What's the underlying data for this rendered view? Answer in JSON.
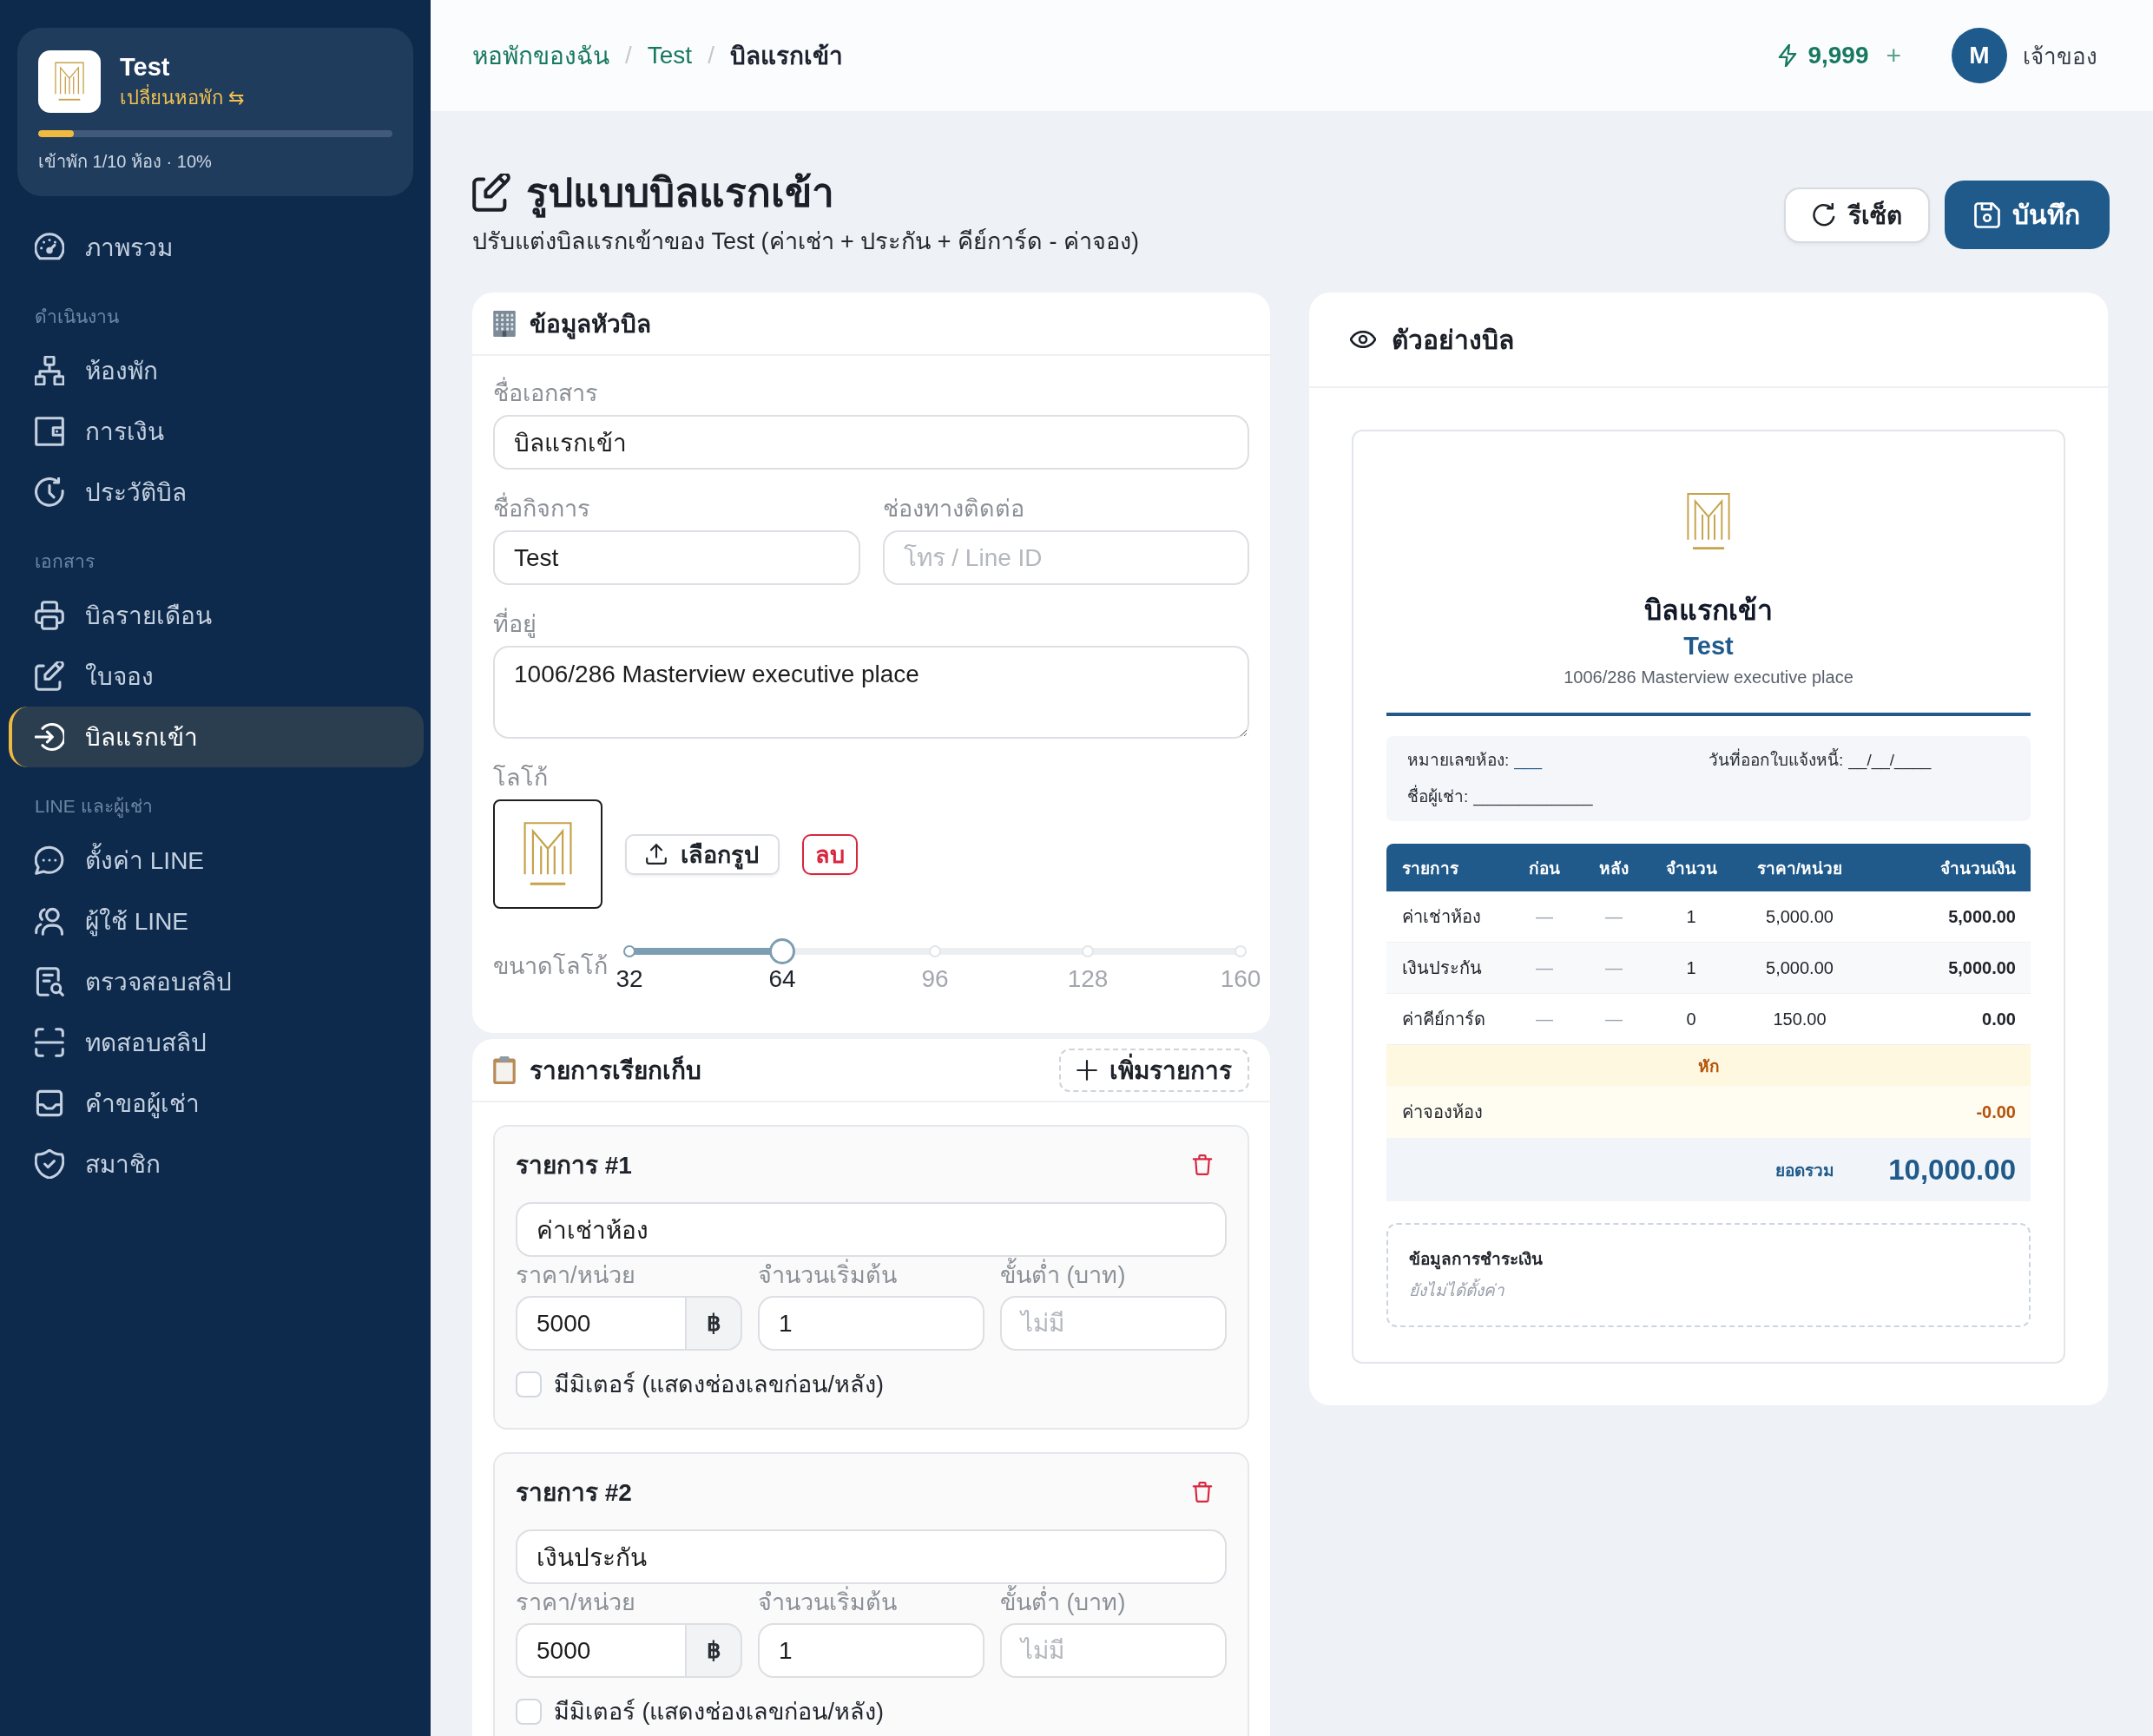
{
  "sidebar": {
    "property": {
      "name": "Test",
      "switch_label": "เปลี่ยนหอพัก ⇆",
      "occupancy": {
        "level": 0.1,
        "text": "เข้าพัก 1/10 ห้อง · 10%"
      }
    },
    "groups": [
      {
        "items": [
          {
            "label": "ภาพรวม",
            "selected": false
          }
        ]
      },
      {
        "heading": "ดำเนินงาน",
        "items": [
          {
            "label": "ห้องพัก",
            "selected": false
          },
          {
            "label": "การเงิน",
            "selected": false
          },
          {
            "label": "ประวัติบิล",
            "selected": false
          }
        ]
      },
      {
        "heading": "เอกสาร",
        "items": [
          {
            "label": "บิลรายเดือน",
            "selected": false
          },
          {
            "label": "ใบจอง",
            "selected": false
          },
          {
            "label": "บิลแรกเข้า",
            "selected": true
          }
        ]
      },
      {
        "heading": "LINE และผู้เช่า",
        "items": [
          {
            "label": "ตั้งค่า LINE",
            "selected": false
          },
          {
            "label": "ผู้ใช้ LINE",
            "selected": false
          },
          {
            "label": "ตรวจสอบสลิป",
            "selected": false
          },
          {
            "label": "ทดสอบสลิป",
            "selected": false
          },
          {
            "label": "คำขอผู้เช่า",
            "selected": false
          },
          {
            "label": "สมาชิก",
            "selected": false
          }
        ]
      }
    ]
  },
  "topbar": {
    "breadcrumb": {
      "separator": "/",
      "items": [
        {
          "label": "หอพักของฉัน",
          "kind": "link"
        },
        {
          "label": "Test",
          "kind": "link"
        },
        {
          "label": "บิลแรกเข้า",
          "kind": "current"
        }
      ]
    },
    "credits": {
      "value": "9,999",
      "add": "+"
    },
    "user": {
      "initial": "M",
      "role": "เจ้าของ"
    }
  },
  "page_header": {
    "title": "รูปแบบบิลแรกเข้า",
    "subtitle": "ปรับแต่งบิลแรกเข้าของ Test (ค่าเช่า + ประกัน + คีย์การ์ด - ค่าจอง)",
    "actions": [
      {
        "kind": "secondary",
        "label": "รีเซ็ต"
      },
      {
        "kind": "primary",
        "label": "บันทึก"
      }
    ]
  },
  "bill_header": {
    "title": "ข้อมูลหัวบิล",
    "rows": [
      [
        {
          "kind": "text",
          "label": "ชื่อเอกสาร",
          "value": "บิลแรกเข้า"
        }
      ],
      [
        {
          "kind": "text",
          "label": "ชื่อกิจการ",
          "value": "Test"
        },
        {
          "kind": "text",
          "label": "ช่องทางติดต่อ",
          "placeholder": "โทร / Line ID"
        }
      ],
      [
        {
          "kind": "textarea",
          "label": "ที่อยู่",
          "value": "1006/286 Masterview executive place"
        }
      ]
    ],
    "logo": {
      "label": "โลโก้",
      "choose_button": "เลือกรูป",
      "remove_button": "ลบ"
    },
    "logo_size": {
      "label": "ขนาดโลโก้",
      "level": 0.25,
      "ticks": [
        "32",
        "64",
        "96",
        "128",
        "160"
      ]
    }
  },
  "charges": {
    "title": "รายการเรียกเก็บ",
    "add_button": "เพิ่มรายการ",
    "items": [
      {
        "title": "รายการ #1",
        "name": "ค่าเช่าห้อง",
        "fields": [
          {
            "kind": "price",
            "label": "ราคา/หน่วย",
            "value": "5000",
            "suffix": "฿"
          },
          {
            "kind": "number",
            "label": "จำนวนเริ่มต้น",
            "value": "1"
          },
          {
            "kind": "number",
            "label": "ขั้นต่ำ (บาท)",
            "placeholder": "ไม่มี"
          }
        ],
        "meter": {
          "label": "มีมิเตอร์ (แสดงช่องเลขก่อน/หลัง)",
          "checked": false
        }
      },
      {
        "title": "รายการ #2",
        "name": "เงินประกัน",
        "fields": [
          {
            "kind": "price",
            "label": "ราคา/หน่วย",
            "value": "5000",
            "suffix": "฿"
          },
          {
            "kind": "number",
            "label": "จำนวนเริ่มต้น",
            "value": "1"
          },
          {
            "kind": "number",
            "label": "ขั้นต่ำ (บาท)",
            "placeholder": "ไม่มี"
          }
        ],
        "meter": {
          "label": "มีมิเตอร์ (แสดงช่องเลขก่อน/หลัง)",
          "checked": false
        }
      }
    ]
  },
  "preview": {
    "title": "ตัวอย่างบิล",
    "bill": {
      "title": "บิลแรกเข้า",
      "business": "Test",
      "address": "1006/286 Masterview executive place",
      "info": [
        {
          "label": "หมายเลขห้อง:",
          "value": "___",
          "accent": true
        },
        {
          "label": "วันที่ออกใบแจ้งหนี้:",
          "value": "__/__/____",
          "accent": false
        },
        {
          "label": "ชื่อผู้เช่า:",
          "value": "_____________",
          "accent": false
        }
      ],
      "table": {
        "columns": [
          "รายการ",
          "ก่อน",
          "หลัง",
          "จำนวน",
          "ราคา/หน่วย",
          "จำนวนเงิน"
        ],
        "rows": [
          [
            "ค่าเช่าห้อง",
            "—",
            "—",
            "1",
            "5,000.00",
            "5,000.00"
          ],
          [
            "เงินประกัน",
            "—",
            "—",
            "1",
            "5,000.00",
            "5,000.00"
          ],
          [
            "ค่าคีย์การ์ด",
            "—",
            "—",
            "0",
            "150.00",
            "0.00"
          ]
        ]
      },
      "deductions": {
        "heading": "หัก",
        "rows": [
          {
            "label": "ค่าจองห้อง",
            "amount": "-0.00"
          }
        ]
      },
      "total": {
        "label": "ยอดรวม",
        "amount": "10,000.00"
      },
      "payment": {
        "title": "ข้อมูลการชำระเงิน",
        "note": "ยังไม่ได้ตั้งค่า"
      }
    }
  }
}
